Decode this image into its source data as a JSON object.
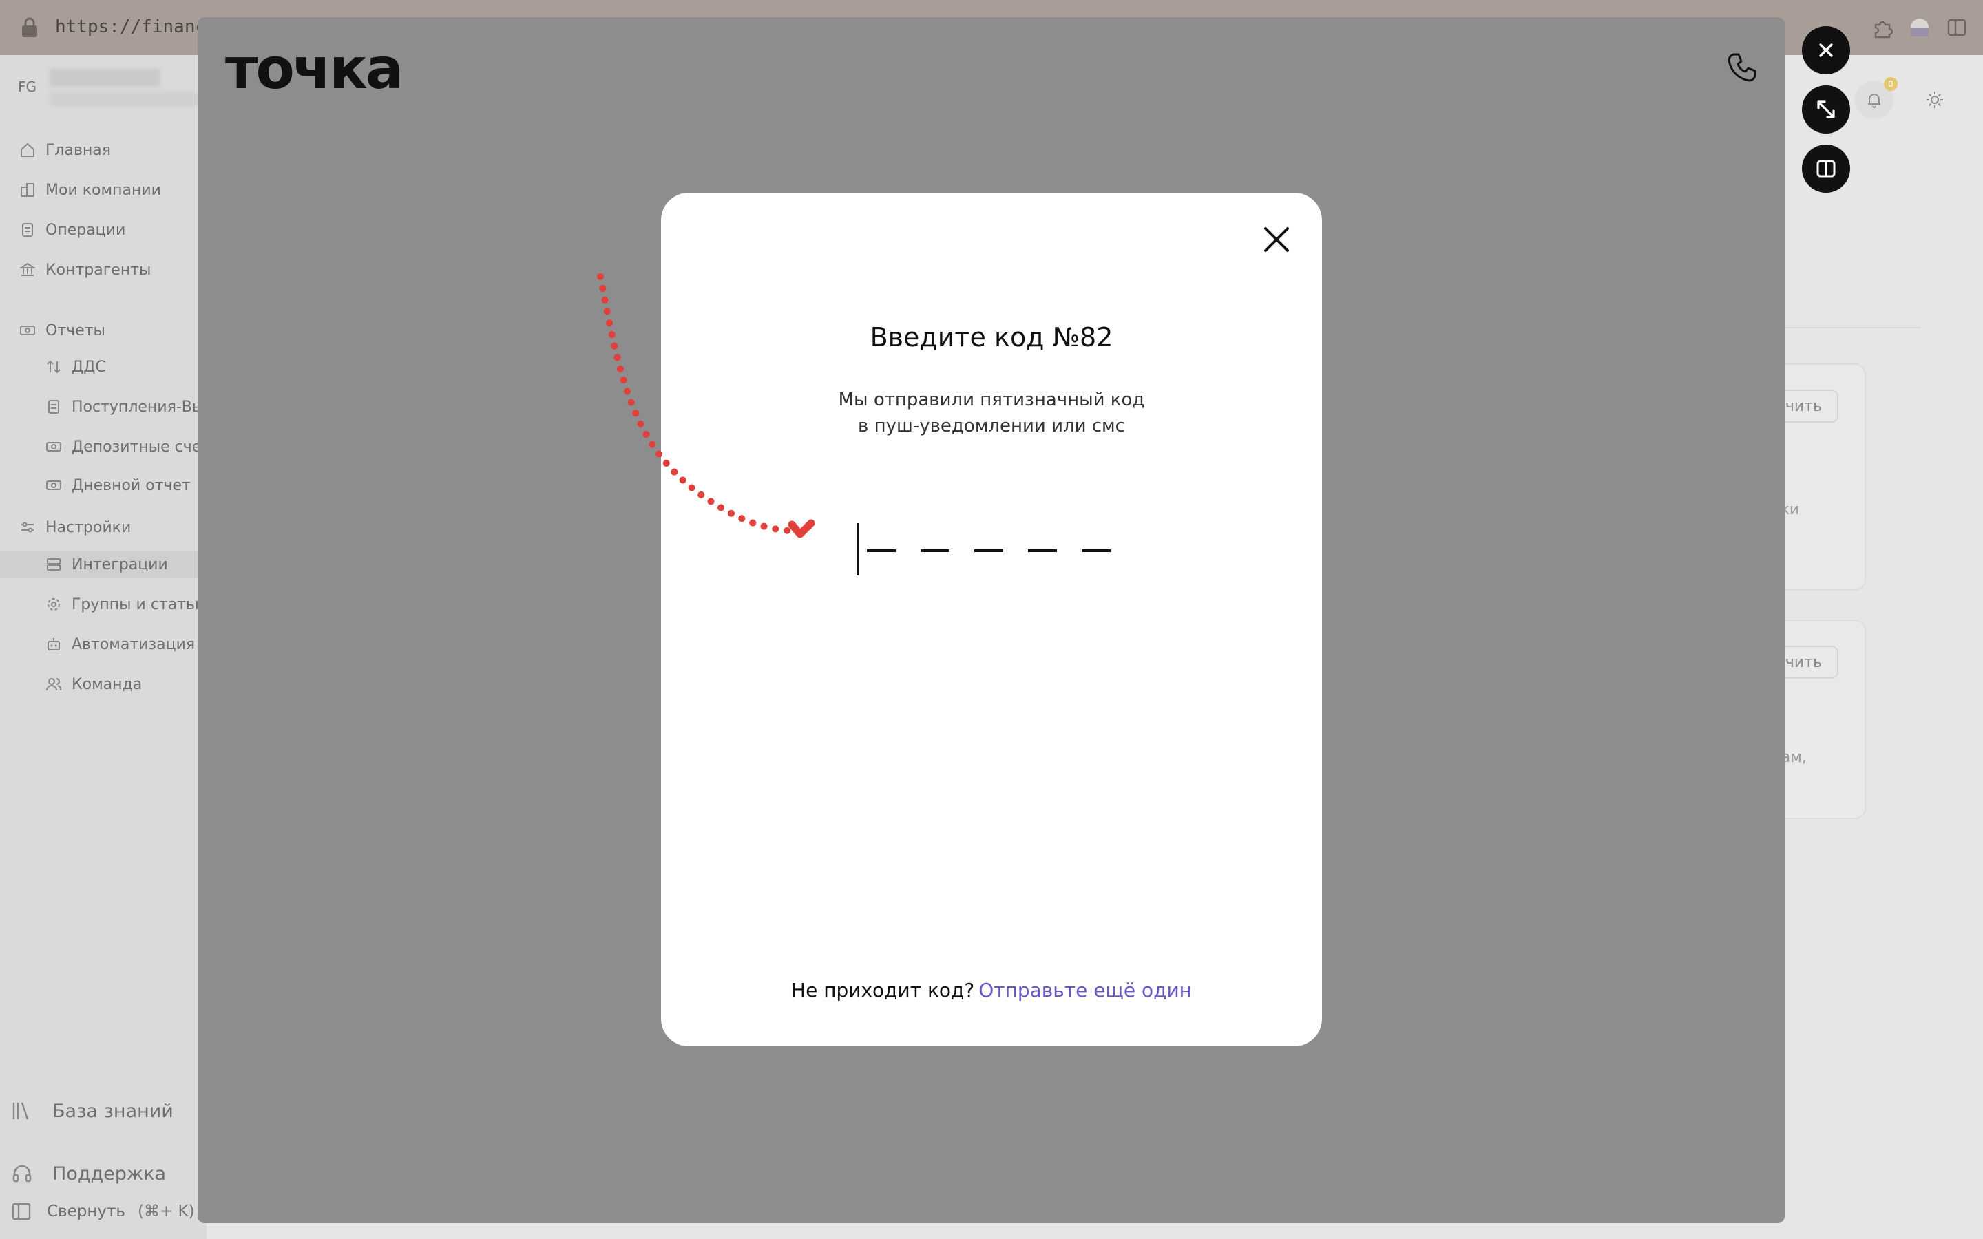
{
  "browser": {
    "url": "https://financeg"
  },
  "sidebar": {
    "org_initials": "FG",
    "items": [
      {
        "label": "Главная"
      },
      {
        "label": "Мои компании"
      },
      {
        "label": "Операции"
      },
      {
        "label": "Контрагенты"
      },
      {
        "label": "Отчеты"
      },
      {
        "label": "ДДС"
      },
      {
        "label": "Поступления-Вы"
      },
      {
        "label": "Депозитные счет"
      },
      {
        "label": "Дневной отчет"
      },
      {
        "label": "Настройки"
      },
      {
        "label": "Интеграции"
      },
      {
        "label": "Группы и статьи"
      },
      {
        "label": "Автоматизация п"
      },
      {
        "label": "Команда"
      }
    ],
    "bottom": {
      "knowledge_base": "База знаний",
      "support": "Поддержка",
      "collapse": "Свернуть",
      "collapse_shortcut": "(⌘+ K)"
    }
  },
  "background_right": {
    "notification_count": "0",
    "button1": "чить",
    "button2": "чить",
    "text1": "ески",
    "text2a": "ртам,",
    "text2b": "."
  },
  "panel": {
    "logo": "точка"
  },
  "modal": {
    "title": "Введите код №82",
    "subtitle_line1": "Мы отправили пятизначный код",
    "subtitle_line2": "в пуш-уведомлении или смс",
    "code_slots": 5,
    "footer_text": "Не приходит код?",
    "resend_link": "Отправьте ещё один"
  },
  "colors": {
    "accent_link": "#6b55c9",
    "annotation_arrow": "#e0403a",
    "overlay_bg": "#8d8d8d",
    "fab_bg": "#111111"
  }
}
